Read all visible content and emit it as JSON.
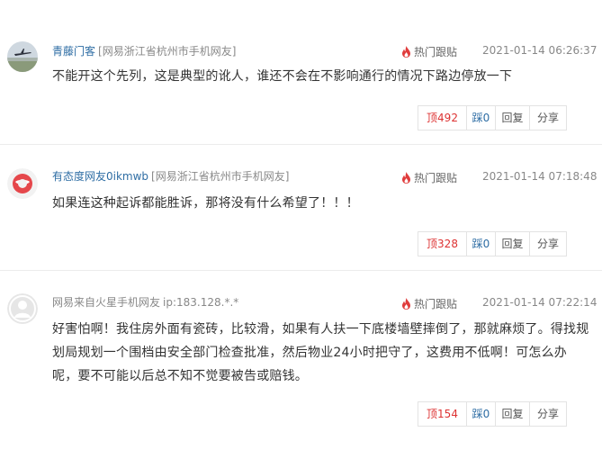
{
  "comments": [
    {
      "user": "青藤门客",
      "location": "[网易浙江省杭州市手机网友]",
      "hot_label": "热门跟贴",
      "time": "2021-01-14 06:26:37",
      "text": "不能开这个先列，这是典型的讹人，谁还不会在不影响通行的情况下路边停放一下",
      "up": "顶492",
      "down": "踩0",
      "reply": "回复",
      "share": "分享"
    },
    {
      "user": "有态度网友0ikmwb",
      "location": "[网易浙江省杭州市手机网友]",
      "hot_label": "热门跟贴",
      "time": "2021-01-14 07:18:48",
      "text": "如果连这种起诉都能胜诉，那将没有什么希望了！！！",
      "up": "顶328",
      "down": "踩0",
      "reply": "回复",
      "share": "分享"
    },
    {
      "user": "网易来自火星手机网友",
      "location": "ip:183.128.*.*",
      "hot_label": "热门跟贴",
      "time": "2021-01-14 07:22:14",
      "text": "好害怕啊！我住房外面有瓷砖，比较滑，如果有人扶一下底楼墙壁摔倒了，那就麻烦了。得找规划局规划一个围档由安全部门检查批准，然后物业24小时把守了，这费用不低啊！可怎么办呢，要不可能以后总不知不觉要被告或赔钱。",
      "up": "顶154",
      "down": "踩0",
      "reply": "回复",
      "share": "分享"
    }
  ],
  "colors": {
    "link": "#2e6da4",
    "up": "#dd3333",
    "flame": "#e03c3c",
    "muted": "#888888"
  },
  "icons": [
    "avatar-photo",
    "avatar-netease-logo",
    "avatar-default-user",
    "flame-icon"
  ]
}
